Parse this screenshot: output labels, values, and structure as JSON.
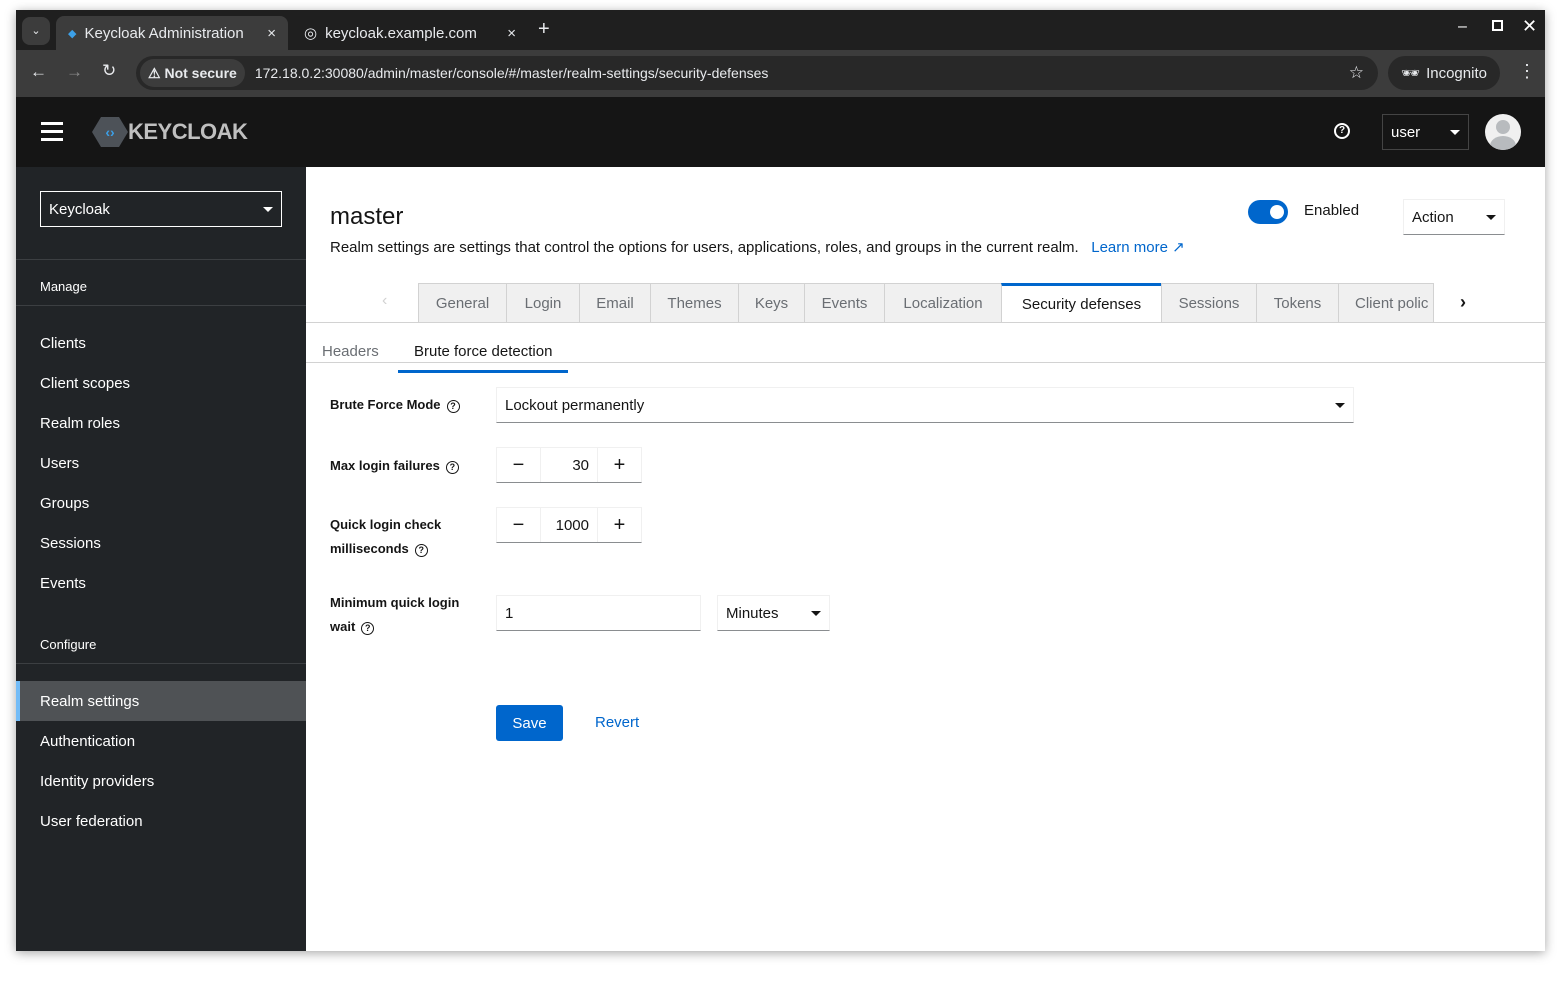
{
  "browser": {
    "tabs": [
      {
        "title": "Keycloak Administration"
      },
      {
        "title": "keycloak.example.com"
      }
    ],
    "not_secure": "Not secure",
    "url": "172.18.0.2:30080/admin/master/console/#/master/realm-settings/security-defenses",
    "incognito": "Incognito"
  },
  "header": {
    "logo": "KEYCLOAK",
    "user": "user"
  },
  "sidebar": {
    "realm": "Keycloak",
    "manage": "Manage",
    "manage_items": [
      "Clients",
      "Client scopes",
      "Realm roles",
      "Users",
      "Groups",
      "Sessions",
      "Events"
    ],
    "configure": "Configure",
    "configure_items": [
      "Realm settings",
      "Authentication",
      "Identity providers",
      "User federation"
    ],
    "active": "Realm settings"
  },
  "page": {
    "title": "master",
    "description": "Realm settings are settings that control the options for users, applications, roles, and groups in the current realm.",
    "learn_more": "Learn more",
    "enabled_label": "Enabled",
    "enabled": true,
    "action": "Action"
  },
  "tabs": [
    "General",
    "Login",
    "Email",
    "Themes",
    "Keys",
    "Events",
    "Localization",
    "Security defenses",
    "Sessions",
    "Tokens",
    "Client polic"
  ],
  "subtabs": [
    "Headers",
    "Brute force detection"
  ],
  "form": {
    "mode_label": "Brute Force Mode",
    "mode_value": "Lockout permanently",
    "max_label": "Max login failures",
    "max_value": "30",
    "quick_label_1": "Quick login check",
    "quick_label_2": "milliseconds",
    "quick_value": "1000",
    "min_label_1": "Minimum quick login",
    "min_label_2": "wait",
    "min_value": "1",
    "min_unit": "Minutes",
    "save": "Save",
    "revert": "Revert"
  },
  "colors": {
    "accent": "#0066cc",
    "sidebar": "#212427",
    "header": "#151515"
  }
}
